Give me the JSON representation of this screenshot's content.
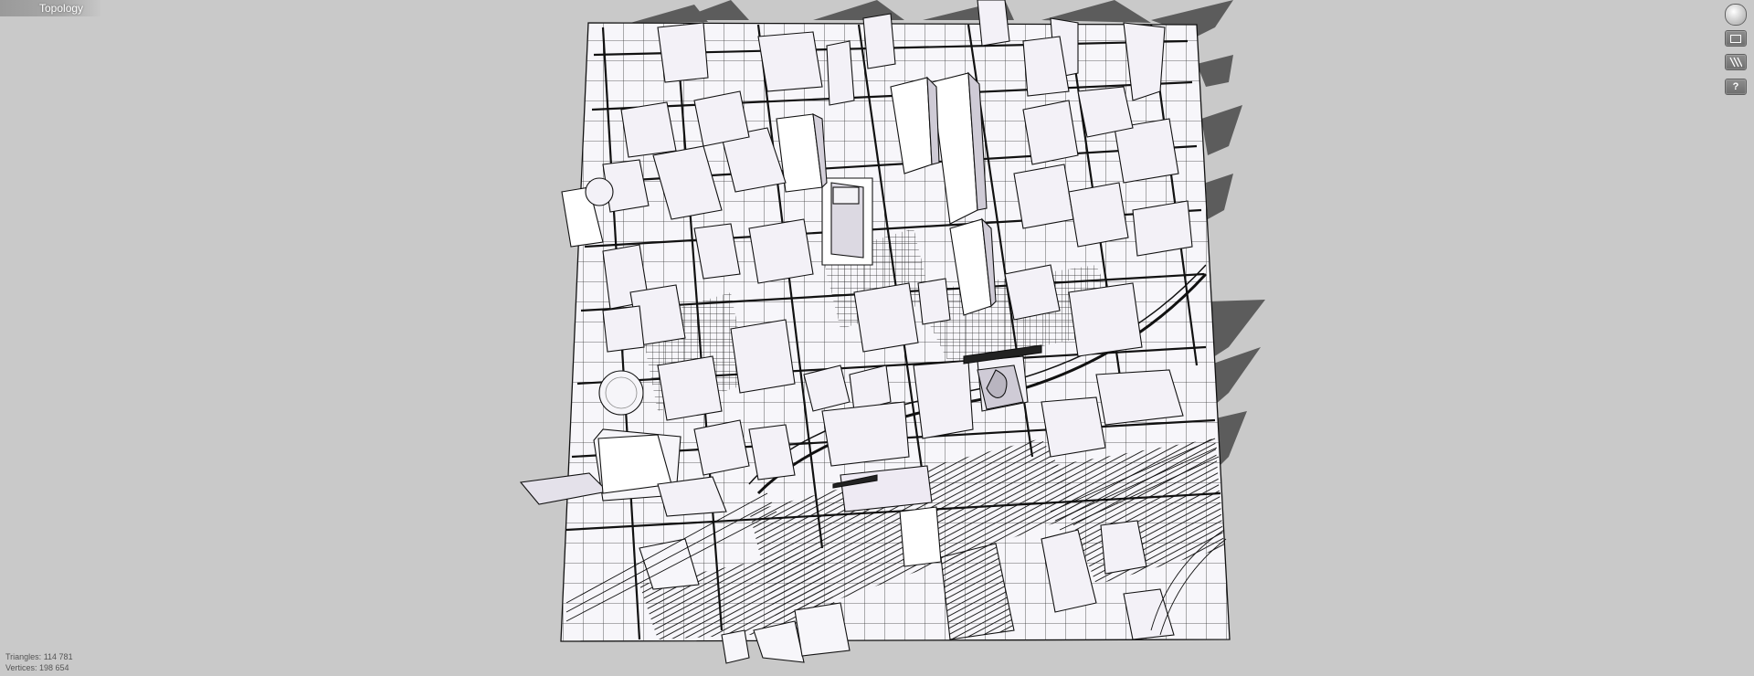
{
  "app": {
    "mode_tab": "Topology"
  },
  "toolbar": {
    "items": [
      {
        "icon": "navigate-globe-icon"
      },
      {
        "icon": "panel-icon"
      },
      {
        "icon": "hatch-style-icon"
      },
      {
        "icon": "help-icon",
        "label": "?"
      }
    ]
  },
  "stats": {
    "triangles_label": "Triangles:",
    "triangles_value": "114 781",
    "vertices_label": "Vertices:",
    "vertices_value": "198 654"
  },
  "colors": {
    "background": "#c9c9c9",
    "model_fill": "#f6f4f8",
    "edge": "#111111",
    "shadow": "#3a3a3a"
  }
}
